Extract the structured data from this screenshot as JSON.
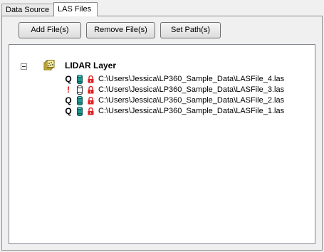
{
  "tabs": [
    {
      "label": "Data Source",
      "active": false
    },
    {
      "label": "LAS Files",
      "active": true
    }
  ],
  "toolbar": {
    "add_label": "Add File(s)",
    "remove_label": "Remove File(s)",
    "set_path_label": "Set Path(s)"
  },
  "tree": {
    "layer": {
      "label": "LIDAR Layer",
      "expanded": true,
      "icon": "lidar-layer-icon"
    },
    "files": [
      {
        "status_glyph": "Q",
        "status": "query",
        "path": "C:\\Users\\Jessica\\LP360_Sample_Data\\LASFile_4.las"
      },
      {
        "status_glyph": "!",
        "status": "warning",
        "path": "C:\\Users\\Jessica\\LP360_Sample_Data\\LASFile_3.las"
      },
      {
        "status_glyph": "Q",
        "status": "query",
        "path": "C:\\Users\\Jessica\\LP360_Sample_Data\\LASFile_2.las"
      },
      {
        "status_glyph": "Q",
        "status": "query",
        "path": "C:\\Users\\Jessica\\LP360_Sample_Data\\LASFile_1.las"
      }
    ]
  },
  "colors": {
    "warning": "#e00000",
    "cylinder_teal": "#1a9a92",
    "lock_red": "#e02020"
  }
}
